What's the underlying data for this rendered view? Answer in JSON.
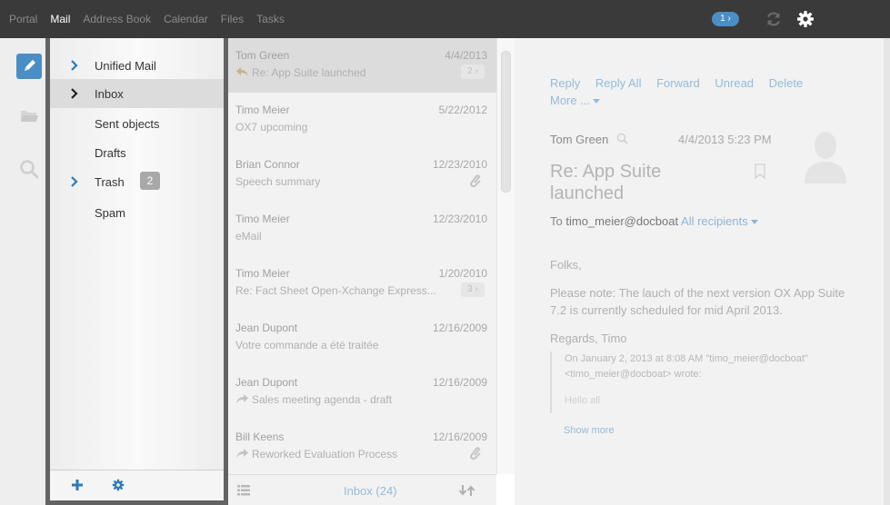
{
  "topnav": {
    "items": [
      "Portal",
      "Mail",
      "Address Book",
      "Calendar",
      "Files",
      "Tasks"
    ],
    "active": "Mail",
    "notification_badge": "1 ›"
  },
  "colors": {
    "accent": "#4a8ec5",
    "topbar": "#3a3a3a",
    "folder_border": "#636363"
  },
  "rail": {
    "icons": [
      "compose-icon",
      "folder-icon",
      "search-icon"
    ]
  },
  "folders": {
    "items": [
      {
        "label": "Unified Mail",
        "chevron": true
      },
      {
        "label": "Inbox",
        "chevron": true,
        "selected": true
      },
      {
        "label": "Sent objects",
        "chevron": false
      },
      {
        "label": "Drafts",
        "chevron": false
      },
      {
        "label": "Trash",
        "chevron": true,
        "badge": "2"
      },
      {
        "label": "Spam",
        "chevron": false
      }
    ],
    "footer_icons": [
      "add-folder-icon",
      "folder-settings-icon"
    ]
  },
  "messages": {
    "items": [
      {
        "from": "Tom Green",
        "date": "4/4/2013",
        "subject": "Re: App Suite launched",
        "icon": "reply",
        "thread": "2 ›",
        "selected": true
      },
      {
        "from": "Timo Meier",
        "date": "5/22/2012",
        "subject": "OX7 upcoming"
      },
      {
        "from": "Brian Connor",
        "date": "12/23/2010",
        "subject": "Speech summary",
        "attachment": true
      },
      {
        "from": "Timo Meier",
        "date": "12/23/2010",
        "subject": "eMail"
      },
      {
        "from": "Timo Meier",
        "date": "1/20/2010",
        "subject": "Re: Fact Sheet Open-Xchange Express...",
        "thread": "3 ›"
      },
      {
        "from": "Jean Dupont",
        "date": "12/16/2009",
        "subject": "Votre commande a été traitée"
      },
      {
        "from": "Jean Dupont",
        "date": "12/16/2009",
        "subject": "Sales meeting agenda - draft",
        "icon": "forward"
      },
      {
        "from": "Bill Keens",
        "date": "12/16/2009",
        "subject": "Reworked Evaluation Process",
        "icon": "forward",
        "attachment": true
      }
    ],
    "footer_label": "Inbox (24)"
  },
  "reader": {
    "toolbar": [
      "Reply",
      "Reply All",
      "Forward",
      "Unread",
      "Delete",
      "More ..."
    ],
    "sender": "Tom Green",
    "date": "4/4/2013 5:23 PM",
    "subject": "Re: App Suite launched",
    "to_label": "To",
    "to_address": "timo_meier@docboat",
    "all_recipients": "All recipients",
    "body": [
      "Folks,",
      "Please note: The lauch of the next version OX App Suite 7.2 is currently scheduled for mid April 2013.",
      "Regards, Timo"
    ],
    "quote": "On January 2, 2013 at 8:08 AM \"timo_meier@docboat\" <timo_meier@docboat> wrote:",
    "quote_fade": "Hello all",
    "show_more": "Show more"
  }
}
